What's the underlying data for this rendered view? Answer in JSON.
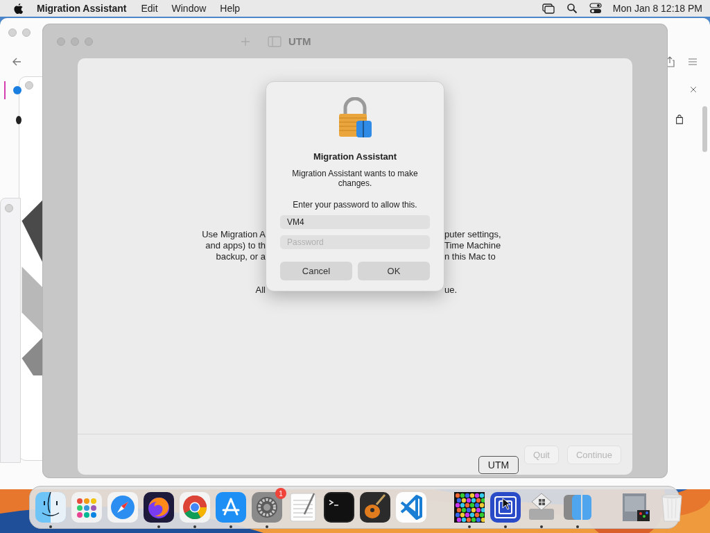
{
  "menu_bar": {
    "app_name": "Migration Assistant",
    "menus": [
      "Edit",
      "Window",
      "Help"
    ],
    "clock": "Mon Jan 8 12:18 PM"
  },
  "utm_window": {
    "title": "UTM"
  },
  "migration_window": {
    "intro_left": [
      "Use Migration A",
      "and apps) to th",
      "backup, or a"
    ],
    "intro_right": [
      "puter settings,",
      "Time Machine",
      "n this Mac to"
    ],
    "note_left": "All",
    "note_right": "ue.",
    "buttons": [
      {
        "label": "Quit",
        "disabled": true
      },
      {
        "label": "Continue",
        "disabled": true
      }
    ]
  },
  "auth_dialog": {
    "title": "Migration Assistant",
    "message": "Migration Assistant wants to make changes.",
    "prompt": "Enter your password to allow this.",
    "username": {
      "value": "VM4"
    },
    "password": {
      "placeholder": "Password"
    },
    "buttons": [
      "Cancel",
      "OK"
    ]
  },
  "dock": {
    "tooltip": "UTM",
    "items": [
      {
        "kind": "finder",
        "running": true
      },
      {
        "kind": "launchpad",
        "running": false
      },
      {
        "kind": "safari",
        "running": false
      },
      {
        "kind": "firefox",
        "running": true
      },
      {
        "kind": "chrome",
        "running": true
      },
      {
        "kind": "appstore",
        "running": true
      },
      {
        "kind": "settings",
        "running": true,
        "badge": "1"
      },
      {
        "kind": "textedit",
        "running": false
      },
      {
        "kind": "terminal",
        "running": false
      },
      {
        "kind": "garageband",
        "running": false
      },
      {
        "kind": "vscode",
        "running": false
      },
      {
        "kind": "separator"
      },
      {
        "kind": "bubbles",
        "running": true
      },
      {
        "kind": "utm",
        "running": true
      },
      {
        "kind": "bootcamp",
        "running": true
      },
      {
        "kind": "migration",
        "running": true
      },
      {
        "kind": "separator"
      },
      {
        "kind": "stack"
      },
      {
        "kind": "trash"
      }
    ]
  }
}
